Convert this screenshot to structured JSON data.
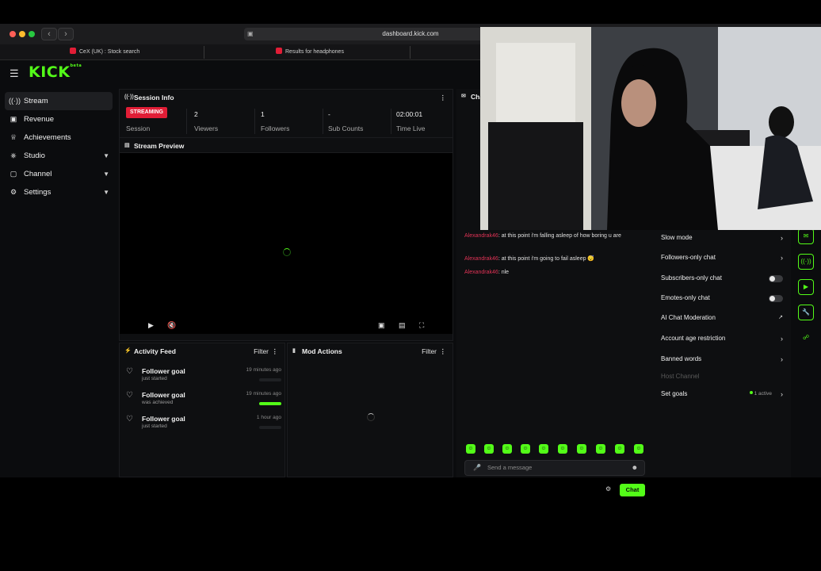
{
  "browser": {
    "url": "dashboard.kick.com",
    "back_icon": "chevron-left-icon",
    "forward_icon": "chevron-right-icon",
    "tabs": [
      {
        "label": "CeX (UK) : Stock search",
        "favicon_color": "#e11d36"
      },
      {
        "label": "Results for headphones",
        "favicon_color": "#e11d36"
      }
    ]
  },
  "app": {
    "logo": "KICK",
    "logo_sup": "beta",
    "accent_color": "#53fc18",
    "sidebar": [
      {
        "label": "Stream",
        "icon": "broadcast-icon",
        "active": true
      },
      {
        "label": "Revenue",
        "icon": "wallet-icon"
      },
      {
        "label": "Achievements",
        "icon": "trophy-icon"
      },
      {
        "label": "Studio",
        "icon": "studio-icon",
        "expandable": true
      },
      {
        "label": "Channel",
        "icon": "channel-icon",
        "expandable": true
      },
      {
        "label": "Settings",
        "icon": "gear-icon",
        "expandable": true
      }
    ]
  },
  "session_info": {
    "title": "Session Info",
    "badge": "STREAMING",
    "stats": [
      {
        "value": "",
        "label": "Session"
      },
      {
        "value": "2",
        "label": "Viewers"
      },
      {
        "value": "1",
        "label": "Followers"
      },
      {
        "value": "-",
        "label": "Sub Counts"
      },
      {
        "value": "02:00:01",
        "label": "Time Live"
      }
    ]
  },
  "stream_preview": {
    "title": "Stream Preview"
  },
  "activity_feed": {
    "title": "Activity Feed",
    "filter": "Filter",
    "items": [
      {
        "title": "Follower goal",
        "status": "just started",
        "time": "19 minutes ago",
        "progress": 0
      },
      {
        "title": "Follower goal",
        "status": "was achieved",
        "time": "19 minutes ago",
        "progress": 1
      },
      {
        "title": "Follower goal",
        "status": "just started",
        "time": "1 hour ago",
        "progress": 0
      }
    ]
  },
  "mod_actions": {
    "title": "Mod Actions",
    "filter": "Filter"
  },
  "chat": {
    "title": "Cha",
    "messages": [
      {
        "user": "Alexandrak46",
        "text": ": at this point i'm falling asleep of how boring u are"
      },
      {
        "user": "Alexandrak46",
        "text": ": at this point i'm going to fail asleep 😴"
      },
      {
        "user": "Alexandrak46",
        "text": ": nle"
      }
    ],
    "input_placeholder": "Send a message",
    "send_label": "Chat"
  },
  "chat_settings": {
    "items": [
      {
        "label": "Slow mode",
        "type": "chevron"
      },
      {
        "label": "Followers-only chat",
        "type": "chevron"
      },
      {
        "label": "Subscribers-only chat",
        "type": "toggle"
      },
      {
        "label": "Emotes-only chat",
        "type": "toggle"
      },
      {
        "label": "AI Chat Moderation",
        "type": "external"
      },
      {
        "label": "Account age restriction",
        "type": "chevron"
      },
      {
        "label": "Banned words",
        "type": "chevron"
      },
      {
        "label": "Host Channel",
        "type": "disabled"
      },
      {
        "label": "Set goals",
        "type": "chevron",
        "tag": "1 active"
      }
    ]
  }
}
